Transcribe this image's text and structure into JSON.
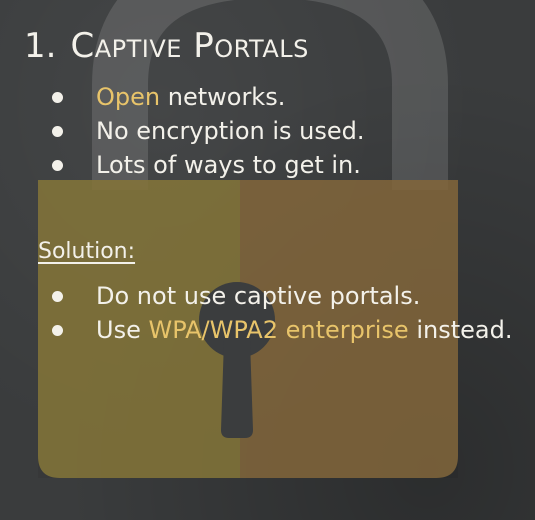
{
  "title": {
    "number": "1.",
    "text": "Captive Portals"
  },
  "bullets_top": [
    {
      "highlight": "Open",
      "rest": " networks."
    },
    {
      "text": "No encryption is used."
    },
    {
      "text": "Lots of ways to get in."
    }
  ],
  "solution": {
    "heading": "Solution:",
    "items": [
      {
        "text": "Do not use captive portals."
      },
      {
        "before": "Use ",
        "highlight": "WPA/WPA2 enterprise",
        "after": " instead."
      }
    ]
  },
  "colors": {
    "background": "#3a3c3d",
    "text": "#f3f1ea",
    "accent": "#e8c46a",
    "lock_body_left": "#8d7d3d",
    "lock_body_right": "#8b6d40",
    "shackle": "#c9c9c7"
  },
  "icons": {
    "background_art": "padlock-icon",
    "bullet": "bullet-dot-icon"
  }
}
